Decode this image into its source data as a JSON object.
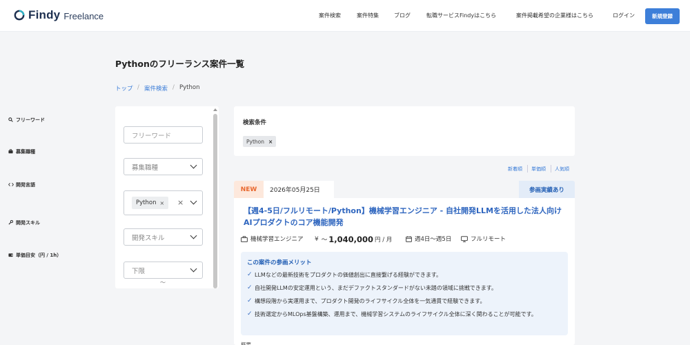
{
  "header": {
    "brand": "Findy",
    "brand_sub": "Freelance",
    "nav": [
      "案件検索",
      "案件特集",
      "ブログ",
      "転職サービスFindyはこちら",
      "案件掲載希望の企業様はこちら",
      "ログイン"
    ],
    "signup_label": "新規登録",
    "accent": "#3d7fd9"
  },
  "page": {
    "title": "Pythonのフリーランス案件一覧",
    "breadcrumb": [
      "トップ",
      "案件検索",
      "Python"
    ]
  },
  "sidebar": {
    "freeword_label": "フリーワード",
    "freeword_placeholder": "フリーワード",
    "job_type_label": "募集職種",
    "job_type_value": "募集職種",
    "language_label": "開発言語",
    "language_chip": "Python",
    "skill_label": "開発スキル",
    "skill_value": "開発スキル",
    "price_label": "単価目安（円 / 1h）",
    "price_min_value": "下限",
    "range_sep": "〜"
  },
  "conditions": {
    "title": "検索条件",
    "chips": [
      "Python"
    ]
  },
  "sort": [
    "新着順",
    "単価順",
    "人気順"
  ],
  "job": {
    "badge": "NEW",
    "date": "2026年05月25日",
    "participation": "参画実績あり",
    "title": "【週4-5日/フルリモート/Python】機械学習エンジニア - 自社開発LLMを活用した法人向けAIプロダクトのコア機能開発",
    "role": "機械学習エンジニア",
    "price_prefix": "〜",
    "price": "1,040,000",
    "price_unit": "円 / 月",
    "days": "週4日〜週5日",
    "remote": "フルリモート",
    "merit_title": "この案件の参画メリット",
    "merits": [
      "LLMなどの最新技術をプロダクトの価値創出に直接繋げる経験ができます。",
      "自社開発LLMの安定運用という、まだデファクトスタンダードがない未踏の領域に挑戦できます。",
      "構想段階から実運用まで、プロダクト開発のライフサイクル全体を一気通貫で経験できます。",
      "技術選定からMLOps基盤構築、運用まで、機械学習システムのライフサイクル全体に深く関わることが可能です。"
    ],
    "next_section": "概要"
  },
  "colors": {
    "link": "#3b7dd8",
    "new_badge_bg": "#fde8dc",
    "new_badge_text": "#e8672d",
    "merit_bg": "#edf3fb"
  }
}
